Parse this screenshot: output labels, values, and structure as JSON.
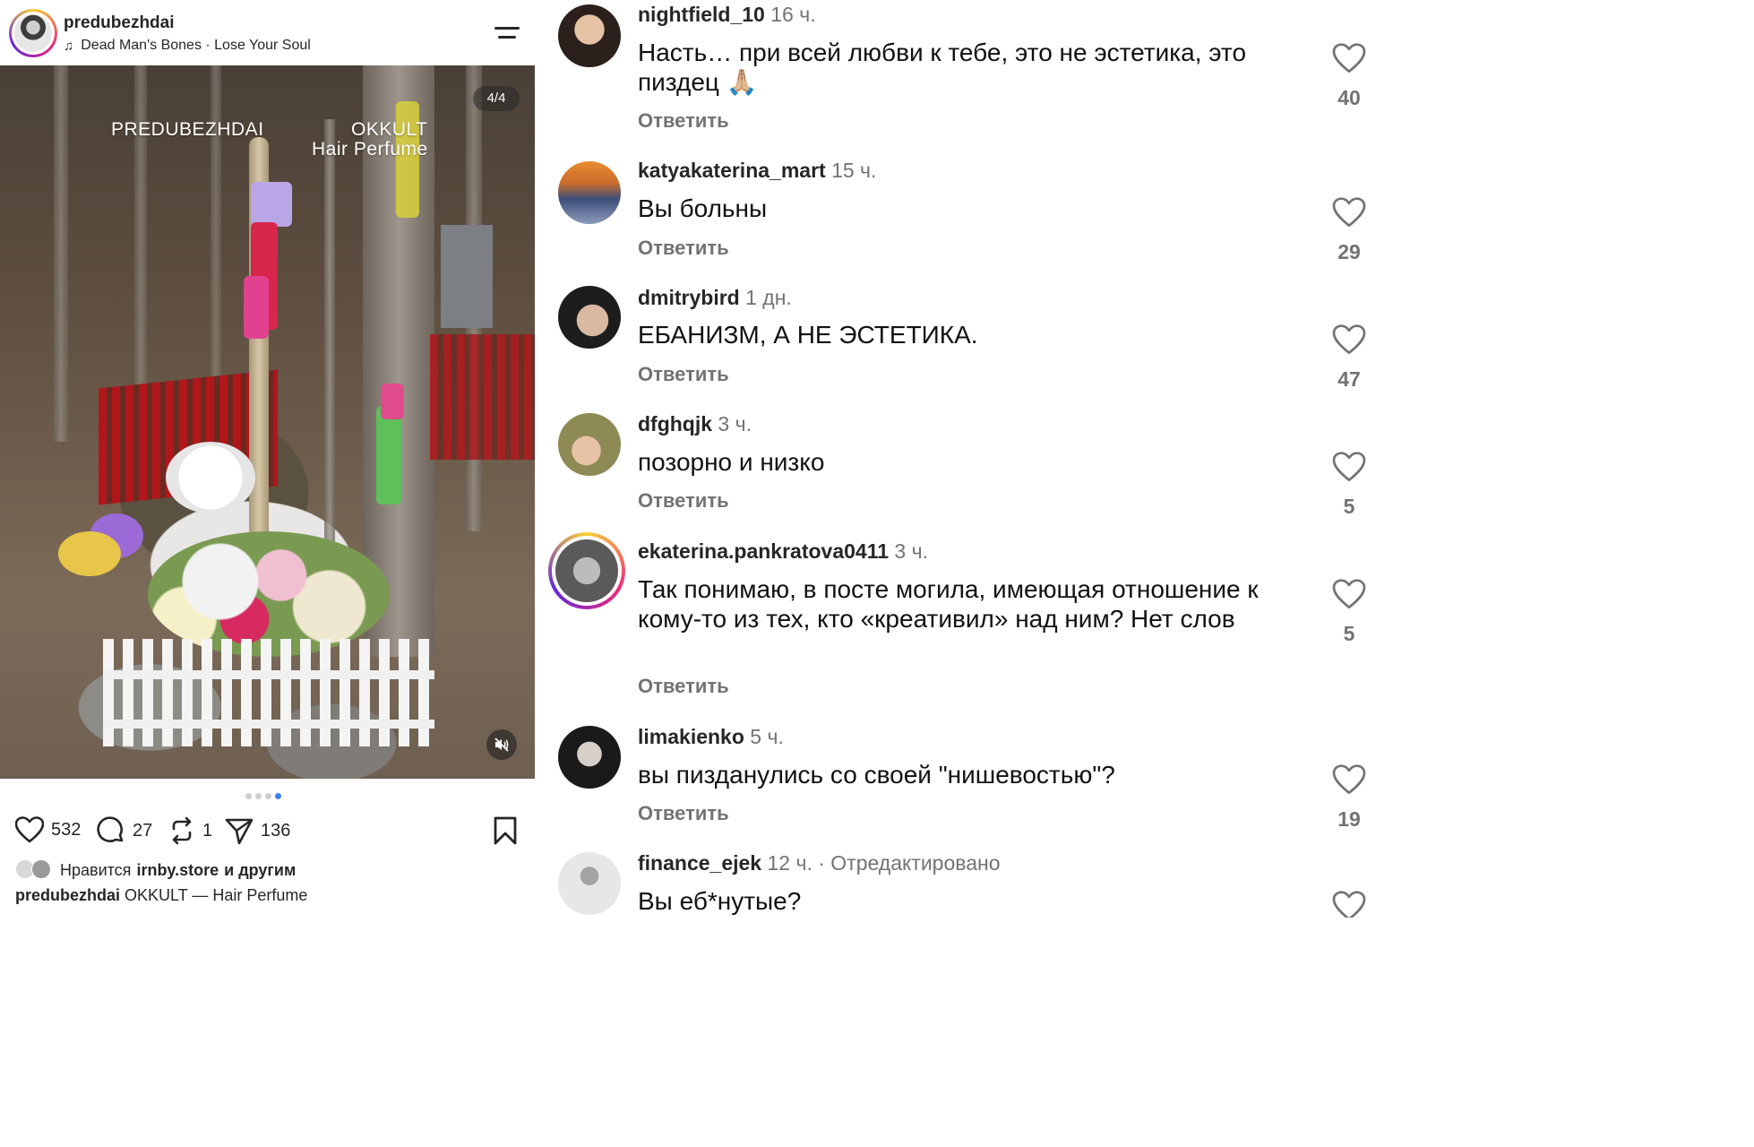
{
  "post": {
    "username": "predubezhdai",
    "music": "Dead Man's Bones · Lose Your Soul",
    "overlay_brand_left": "PREDUBEZHDAI",
    "overlay_brand_right_1": "OKKULT",
    "overlay_brand_right_2": "Hair Perfume",
    "media_counter": "4/4",
    "carousel": {
      "count": 4,
      "active_index": 3
    },
    "likes": "532",
    "comments": "27",
    "reposts": "1",
    "shares": "136",
    "liked_by_prefix": "Нравится",
    "liked_by_user": "irnby.store",
    "liked_by_suffix": "и другим",
    "caption_user": "predubezhdai",
    "caption_text": "OKKULT — Hair Perfume",
    "accent_color": "#3b82f6"
  },
  "comments": [
    {
      "user": "nightfield_10",
      "meta": "16 ч.",
      "text": "Насть… при всей любви к тебе, это не эстетика, это пиздец 🙏🏼",
      "reply": "Ответить",
      "likes": "40"
    },
    {
      "user": "katyakaterina_mart",
      "meta": "15 ч.",
      "text": "Вы больны",
      "reply": "Ответить",
      "likes": "29"
    },
    {
      "user": "dmitrybird",
      "meta": "1 дн.",
      "text": "ЕБАНИЗМ, А НЕ ЭСТЕТИКА.",
      "reply": "Ответить",
      "likes": "47"
    },
    {
      "user": "dfghqjk",
      "meta": "3 ч.",
      "text": "позорно и низко",
      "reply": "Ответить",
      "likes": "5"
    },
    {
      "user": "ekaterina.pankratova0411",
      "meta": "3 ч.",
      "text": "Так понимаю, в посте могила, имеющая отношение к кому-то из тех, кто «креативил» над ним? Нет слов",
      "reply": "Ответить",
      "likes": "5"
    },
    {
      "user": "limakienko",
      "meta": "5 ч.",
      "text": "вы пизданулись со своей \"нишевостью\"?",
      "reply": "Ответить",
      "likes": "19"
    },
    {
      "user": "finance_ejek",
      "meta": "12 ч. · Отредактировано",
      "text": "Вы еб*нутые?",
      "reply": "",
      "likes": ""
    }
  ]
}
